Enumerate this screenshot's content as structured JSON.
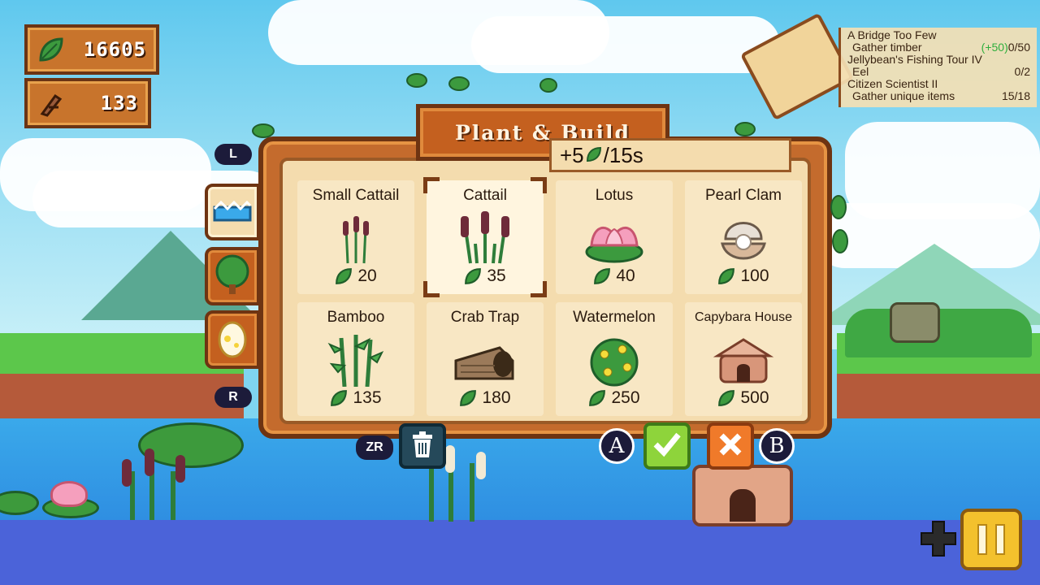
{
  "resources": {
    "leaves": "16605",
    "wood": "133"
  },
  "quests": [
    {
      "title": "A Bridge Too Few",
      "task": "Gather timber",
      "bonus": "(+50)",
      "progress": "0/50"
    },
    {
      "title": "Jellybean's Fishing Tour IV",
      "task": "Eel",
      "bonus": "",
      "progress": "0/2"
    },
    {
      "title": "Citizen Scientist II",
      "task": "Gather unique items",
      "bonus": "",
      "progress": "15/18"
    }
  ],
  "panel": {
    "title": "Plant & Build",
    "rate_prefix": "+5",
    "rate_suffix": "/15s"
  },
  "tabs": {
    "shoulder_left": "L",
    "shoulder_right": "R",
    "items": [
      {
        "icon": "water-icon",
        "active": true
      },
      {
        "icon": "tree-icon",
        "active": false
      },
      {
        "icon": "egg-icon",
        "active": false
      }
    ]
  },
  "items": [
    {
      "name": "Small Cattail",
      "cost": "20",
      "icon": "small-cattail-icon"
    },
    {
      "name": "Cattail",
      "cost": "35",
      "icon": "cattail-icon",
      "selected": true
    },
    {
      "name": "Lotus",
      "cost": "40",
      "icon": "lotus-icon"
    },
    {
      "name": "Pearl Clam",
      "cost": "100",
      "icon": "pearl-clam-icon"
    },
    {
      "name": "Bamboo",
      "cost": "135",
      "icon": "bamboo-icon"
    },
    {
      "name": "Crab Trap",
      "cost": "180",
      "icon": "crab-trap-icon"
    },
    {
      "name": "Watermelon",
      "cost": "250",
      "icon": "watermelon-icon"
    },
    {
      "name": "Capybara House",
      "cost": "500",
      "icon": "capybara-house-icon"
    }
  ],
  "buttons": {
    "zr": "ZR",
    "a": "A",
    "b": "B"
  },
  "colors": {
    "leaf": "#3c9a3e",
    "confirm": "#8ed43b",
    "cancel": "#f07a2a",
    "pause": "#f3c12d",
    "quest_bonus": "#2fae3d"
  }
}
